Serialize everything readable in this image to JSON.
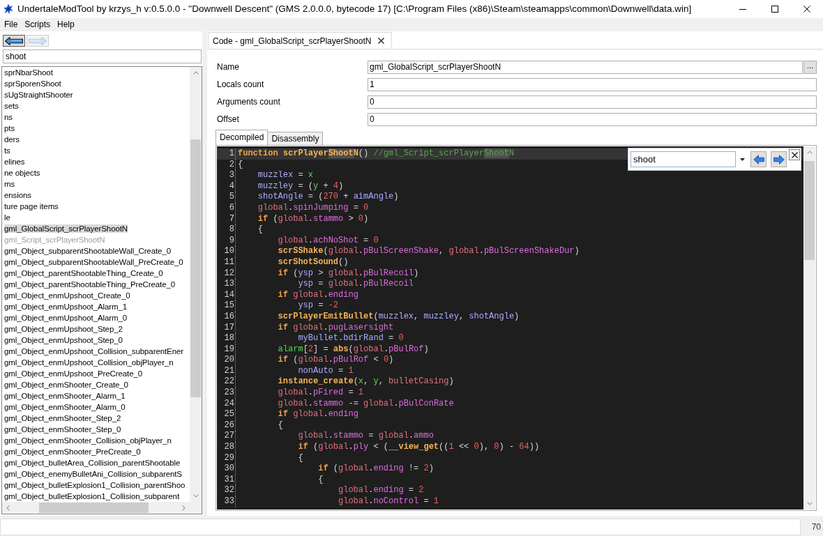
{
  "window": {
    "title": "UndertaleModTool by krzys_h v:0.5.0.0 - \"Downwell Descent\" (GMS 2.0.0.0, bytecode 17) [C:\\Program Files (x86)\\Steam\\steamapps\\common\\Downwell\\data.win]"
  },
  "menu": [
    "File",
    "Scripts",
    "Help"
  ],
  "navigation": {
    "back": {
      "disabled": false
    },
    "forward": {
      "disabled": true
    }
  },
  "tree": {
    "search": {
      "value": "shoot"
    },
    "items": [
      {
        "label": "sprNbarShoot",
        "selected": false,
        "dimmed": false
      },
      {
        "label": "sprSporenShoot",
        "selected": false,
        "dimmed": false
      },
      {
        "label": "sUgStraightShooter",
        "selected": false,
        "dimmed": false
      },
      {
        "label": "sets",
        "selected": false,
        "dimmed": false
      },
      {
        "label": "ns",
        "selected": false,
        "dimmed": false
      },
      {
        "label": "pts",
        "selected": false,
        "dimmed": false
      },
      {
        "label": "ders",
        "selected": false,
        "dimmed": false
      },
      {
        "label": "ts",
        "selected": false,
        "dimmed": false
      },
      {
        "label": "elines",
        "selected": false,
        "dimmed": false
      },
      {
        "label": "ne objects",
        "selected": false,
        "dimmed": false
      },
      {
        "label": "ms",
        "selected": false,
        "dimmed": false
      },
      {
        "label": "ensions",
        "selected": false,
        "dimmed": false
      },
      {
        "label": "ture page items",
        "selected": false,
        "dimmed": false
      },
      {
        "label": "le",
        "selected": false,
        "dimmed": false
      },
      {
        "label": "gml_GlobalScript_scrPlayerShootN",
        "selected": true,
        "dimmed": false
      },
      {
        "label": "gml_Script_scrPlayerShootN",
        "selected": false,
        "dimmed": true
      },
      {
        "label": "gml_Object_subparentShootableWall_Create_0",
        "selected": false,
        "dimmed": false
      },
      {
        "label": "gml_Object_subparentShootableWall_PreCreate_0",
        "selected": false,
        "dimmed": false
      },
      {
        "label": "gml_Object_parentShootableThing_Create_0",
        "selected": false,
        "dimmed": false
      },
      {
        "label": "gml_Object_parentShootableThing_PreCreate_0",
        "selected": false,
        "dimmed": false
      },
      {
        "label": "gml_Object_enmUpshoot_Create_0",
        "selected": false,
        "dimmed": false
      },
      {
        "label": "gml_Object_enmUpshoot_Alarm_1",
        "selected": false,
        "dimmed": false
      },
      {
        "label": "gml_Object_enmUpshoot_Alarm_0",
        "selected": false,
        "dimmed": false
      },
      {
        "label": "gml_Object_enmUpshoot_Step_2",
        "selected": false,
        "dimmed": false
      },
      {
        "label": "gml_Object_enmUpshoot_Step_0",
        "selected": false,
        "dimmed": false
      },
      {
        "label": "gml_Object_enmUpshoot_Collision_subparentEner",
        "selected": false,
        "dimmed": false
      },
      {
        "label": "gml_Object_enmUpshoot_Collision_objPlayer_n",
        "selected": false,
        "dimmed": false
      },
      {
        "label": "gml_Object_enmUpshoot_PreCreate_0",
        "selected": false,
        "dimmed": false
      },
      {
        "label": "gml_Object_enmShooter_Create_0",
        "selected": false,
        "dimmed": false
      },
      {
        "label": "gml_Object_enmShooter_Alarm_1",
        "selected": false,
        "dimmed": false
      },
      {
        "label": "gml_Object_enmShooter_Alarm_0",
        "selected": false,
        "dimmed": false
      },
      {
        "label": "gml_Object_enmShooter_Step_2",
        "selected": false,
        "dimmed": false
      },
      {
        "label": "gml_Object_enmShooter_Step_0",
        "selected": false,
        "dimmed": false
      },
      {
        "label": "gml_Object_enmShooter_Collision_objPlayer_n",
        "selected": false,
        "dimmed": false
      },
      {
        "label": "gml_Object_enmShooter_PreCreate_0",
        "selected": false,
        "dimmed": false
      },
      {
        "label": "gml_Object_bulletArea_Collision_parentShootable",
        "selected": false,
        "dimmed": false
      },
      {
        "label": "gml_Object_enemyBulletAni_Collision_subparentS",
        "selected": false,
        "dimmed": false
      },
      {
        "label": "gml_Object_bulletExplosion1_Collision_parentShoo",
        "selected": false,
        "dimmed": false
      },
      {
        "label": "gml_Object_bulletExplosion1_Collision_subparent",
        "selected": false,
        "dimmed": false
      }
    ]
  },
  "editor_tab": {
    "title": "Code - gml_GlobalScript_scrPlayerShootN"
  },
  "properties": [
    {
      "label": "Name",
      "value": "gml_GlobalScript_scrPlayerShootN",
      "button": "..."
    },
    {
      "label": "Locals count",
      "value": "1"
    },
    {
      "label": "Arguments count",
      "value": "0"
    },
    {
      "label": "Offset",
      "value": "0"
    }
  ],
  "code_tabs": [
    {
      "label": "Decompiled",
      "selected": true
    },
    {
      "label": "Disassembly",
      "selected": false
    }
  ],
  "code": {
    "lines": [
      {
        "number": "1",
        "current": true,
        "tokens": [
          {
            "kind": "keyword",
            "text": "function",
            "match": false
          },
          {
            "kind": "function",
            "text": " scrPlayer",
            "match": false
          },
          {
            "kind": "function",
            "text": "Shoot",
            "match": true
          },
          {
            "kind": "function",
            "text": "N",
            "match": false
          },
          {
            "kind": "punct",
            "text": "() ",
            "match": false
          },
          {
            "kind": "comment",
            "text": "//gml_Script_scrPlayer",
            "match": false
          },
          {
            "kind": "comment",
            "text": "Shoot",
            "match": true
          },
          {
            "kind": "comment",
            "text": "N",
            "match": false
          }
        ]
      },
      {
        "number": "2",
        "current": false,
        "tokens": [
          {
            "kind": "punct",
            "text": "{"
          }
        ],
        "children": [
          {
            "number": "3",
            "current": false,
            "tokens": [
              {
                "kind": "variable",
                "text": "muzzlex"
              },
              {
                "kind": "punct",
                "text": " = "
              },
              {
                "kind": "builtin",
                "text": "x"
              }
            ]
          },
          {
            "number": "4",
            "current": false,
            "tokens": [
              {
                "kind": "variable",
                "text": "muzzley"
              },
              {
                "kind": "punct",
                "text": " = ("
              },
              {
                "kind": "builtin",
                "text": "y"
              },
              {
                "kind": "punct",
                "text": " + "
              },
              {
                "kind": "number",
                "text": "4"
              },
              {
                "kind": "punct",
                "text": ")"
              }
            ]
          },
          {
            "number": "5",
            "current": false,
            "tokens": [
              {
                "kind": "variable",
                "text": "shotAngle"
              },
              {
                "kind": "punct",
                "text": " = ("
              },
              {
                "kind": "number",
                "text": "270"
              },
              {
                "kind": "punct",
                "text": " + "
              },
              {
                "kind": "variable",
                "text": "aimAngle"
              },
              {
                "kind": "punct",
                "text": ")"
              }
            ]
          },
          {
            "number": "6",
            "current": false,
            "tokens": [
              {
                "kind": "global",
                "text": "global"
              },
              {
                "kind": "punct",
                "text": "."
              },
              {
                "kind": "field",
                "text": "spinJumping"
              },
              {
                "kind": "punct",
                "text": " = "
              },
              {
                "kind": "number",
                "text": "0"
              }
            ]
          },
          {
            "number": "7",
            "current": false,
            "tokens": [
              {
                "kind": "keyword",
                "text": "if"
              },
              {
                "kind": "punct",
                "text": " ("
              },
              {
                "kind": "global",
                "text": "global"
              },
              {
                "kind": "punct",
                "text": "."
              },
              {
                "kind": "field",
                "text": "stammo"
              },
              {
                "kind": "punct",
                "text": " > "
              },
              {
                "kind": "number",
                "text": "0"
              },
              {
                "kind": "punct",
                "text": ")"
              }
            ]
          },
          {
            "number": "8",
            "current": false,
            "tokens": [
              {
                "kind": "punct",
                "text": "{"
              }
            ],
            "children": [
              {
                "number": "9",
                "current": false,
                "tokens": [
                  {
                    "kind": "global",
                    "text": "global"
                  },
                  {
                    "kind": "punct",
                    "text": "."
                  },
                  {
                    "kind": "field",
                    "text": "achNoShot"
                  },
                  {
                    "kind": "punct",
                    "text": " = "
                  },
                  {
                    "kind": "number",
                    "text": "0"
                  }
                ]
              },
              {
                "number": "10",
                "current": false,
                "tokens": [
                  {
                    "kind": "function",
                    "text": "scrSShake"
                  },
                  {
                    "kind": "punct",
                    "text": "("
                  },
                  {
                    "kind": "global",
                    "text": "global"
                  },
                  {
                    "kind": "punct",
                    "text": "."
                  },
                  {
                    "kind": "field",
                    "text": "pBulScreenShake"
                  },
                  {
                    "kind": "punct",
                    "text": ", "
                  },
                  {
                    "kind": "global",
                    "text": "global"
                  },
                  {
                    "kind": "punct",
                    "text": "."
                  },
                  {
                    "kind": "field",
                    "text": "pBulScreenShakeDur"
                  },
                  {
                    "kind": "punct",
                    "text": ")"
                  }
                ]
              },
              {
                "number": "11",
                "current": false,
                "tokens": [
                  {
                    "kind": "function",
                    "text": "scrShotSound"
                  },
                  {
                    "kind": "punct",
                    "text": "()"
                  }
                ]
              },
              {
                "number": "12",
                "current": false,
                "tokens": [
                  {
                    "kind": "keyword",
                    "text": "if"
                  },
                  {
                    "kind": "punct",
                    "text": " ("
                  },
                  {
                    "kind": "variable",
                    "text": "ysp"
                  },
                  {
                    "kind": "punct",
                    "text": " > "
                  },
                  {
                    "kind": "global",
                    "text": "global"
                  },
                  {
                    "kind": "punct",
                    "text": "."
                  },
                  {
                    "kind": "field",
                    "text": "pBulRecoil"
                  },
                  {
                    "kind": "punct",
                    "text": ")"
                  }
                ],
                "children": [
                  {
                    "number": "13",
                    "current": false,
                    "tokens": [
                      {
                        "kind": "variable",
                        "text": "ysp"
                      },
                      {
                        "kind": "punct",
                        "text": " = "
                      },
                      {
                        "kind": "global",
                        "text": "global"
                      },
                      {
                        "kind": "punct",
                        "text": "."
                      },
                      {
                        "kind": "field",
                        "text": "pBulRecoil"
                      }
                    ]
                  }
                ]
              },
              {
                "number": "14",
                "current": false,
                "tokens": [
                  {
                    "kind": "keyword",
                    "text": "if "
                  },
                  {
                    "kind": "global",
                    "text": "global"
                  },
                  {
                    "kind": "punct",
                    "text": "."
                  },
                  {
                    "kind": "field",
                    "text": "ending"
                  }
                ],
                "children": [
                  {
                    "number": "15",
                    "current": false,
                    "tokens": [
                      {
                        "kind": "variable",
                        "text": "ysp"
                      },
                      {
                        "kind": "punct",
                        "text": " = "
                      },
                      {
                        "kind": "number",
                        "text": "-2"
                      }
                    ]
                  }
                ]
              },
              {
                "number": "16",
                "current": false,
                "tokens": [
                  {
                    "kind": "function",
                    "text": "scrPlayerEmitBullet"
                  },
                  {
                    "kind": "punct",
                    "text": "("
                  },
                  {
                    "kind": "variable",
                    "text": "muzzlex"
                  },
                  {
                    "kind": "punct",
                    "text": ", "
                  },
                  {
                    "kind": "variable",
                    "text": "muzzley"
                  },
                  {
                    "kind": "punct",
                    "text": ", "
                  },
                  {
                    "kind": "variable",
                    "text": "shotAngle"
                  },
                  {
                    "kind": "punct",
                    "text": ")"
                  }
                ]
              },
              {
                "number": "17",
                "current": false,
                "tokens": [
                  {
                    "kind": "keyword",
                    "text": "if "
                  },
                  {
                    "kind": "global",
                    "text": "global"
                  },
                  {
                    "kind": "punct",
                    "text": "."
                  },
                  {
                    "kind": "field",
                    "text": "pugLasersight"
                  }
                ],
                "children": [
                  {
                    "number": "18",
                    "current": false,
                    "tokens": [
                      {
                        "kind": "variable",
                        "text": "myBullet"
                      },
                      {
                        "kind": "punct",
                        "text": "."
                      },
                      {
                        "kind": "variable",
                        "text": "bdirRand"
                      },
                      {
                        "kind": "punct",
                        "text": " = "
                      },
                      {
                        "kind": "number",
                        "text": "0"
                      }
                    ]
                  }
                ]
              },
              {
                "number": "19",
                "current": false,
                "tokens": [
                  {
                    "kind": "builtin",
                    "text": "alarm"
                  },
                  {
                    "kind": "punct",
                    "text": "["
                  },
                  {
                    "kind": "number",
                    "text": "2"
                  },
                  {
                    "kind": "punct",
                    "text": "] = "
                  },
                  {
                    "kind": "function",
                    "text": "abs"
                  },
                  {
                    "kind": "punct",
                    "text": "("
                  },
                  {
                    "kind": "global",
                    "text": "global"
                  },
                  {
                    "kind": "punct",
                    "text": "."
                  },
                  {
                    "kind": "field",
                    "text": "pBulRof"
                  },
                  {
                    "kind": "punct",
                    "text": ")"
                  }
                ]
              },
              {
                "number": "20",
                "current": false,
                "tokens": [
                  {
                    "kind": "keyword",
                    "text": "if"
                  },
                  {
                    "kind": "punct",
                    "text": " ("
                  },
                  {
                    "kind": "global",
                    "text": "global"
                  },
                  {
                    "kind": "punct",
                    "text": "."
                  },
                  {
                    "kind": "field",
                    "text": "pBulRof"
                  },
                  {
                    "kind": "punct",
                    "text": " < "
                  },
                  {
                    "kind": "number",
                    "text": "0"
                  },
                  {
                    "kind": "punct",
                    "text": ")"
                  }
                ],
                "children": [
                  {
                    "number": "21",
                    "current": false,
                    "tokens": [
                      {
                        "kind": "variable",
                        "text": "nonAuto"
                      },
                      {
                        "kind": "punct",
                        "text": " = "
                      },
                      {
                        "kind": "number",
                        "text": "1"
                      }
                    ]
                  }
                ]
              },
              {
                "number": "22",
                "current": false,
                "tokens": [
                  {
                    "kind": "function",
                    "text": "instance_create"
                  },
                  {
                    "kind": "punct",
                    "text": "("
                  },
                  {
                    "kind": "builtin",
                    "text": "x"
                  },
                  {
                    "kind": "punct",
                    "text": ", "
                  },
                  {
                    "kind": "builtin",
                    "text": "y"
                  },
                  {
                    "kind": "punct",
                    "text": ", "
                  },
                  {
                    "kind": "asset",
                    "text": "bulletCasing"
                  },
                  {
                    "kind": "punct",
                    "text": ")"
                  }
                ]
              },
              {
                "number": "23",
                "current": false,
                "tokens": [
                  {
                    "kind": "global",
                    "text": "global"
                  },
                  {
                    "kind": "punct",
                    "text": "."
                  },
                  {
                    "kind": "field",
                    "text": "pFired"
                  },
                  {
                    "kind": "punct",
                    "text": " = "
                  },
                  {
                    "kind": "number",
                    "text": "1"
                  }
                ]
              },
              {
                "number": "24",
                "current": false,
                "tokens": [
                  {
                    "kind": "global",
                    "text": "global"
                  },
                  {
                    "kind": "punct",
                    "text": "."
                  },
                  {
                    "kind": "field",
                    "text": "stammo"
                  },
                  {
                    "kind": "punct",
                    "text": " -= "
                  },
                  {
                    "kind": "global",
                    "text": "global"
                  },
                  {
                    "kind": "punct",
                    "text": "."
                  },
                  {
                    "kind": "field",
                    "text": "pBulConRate"
                  }
                ]
              },
              {
                "number": "25",
                "current": false,
                "tokens": [
                  {
                    "kind": "keyword",
                    "text": "if "
                  },
                  {
                    "kind": "global",
                    "text": "global"
                  },
                  {
                    "kind": "punct",
                    "text": "."
                  },
                  {
                    "kind": "field",
                    "text": "ending"
                  }
                ]
              },
              {
                "number": "26",
                "current": false,
                "tokens": [
                  {
                    "kind": "punct",
                    "text": "{"
                  }
                ],
                "children": [
                  {
                    "number": "27",
                    "current": false,
                    "tokens": [
                      {
                        "kind": "global",
                        "text": "global"
                      },
                      {
                        "kind": "punct",
                        "text": "."
                      },
                      {
                        "kind": "field",
                        "text": "stammo"
                      },
                      {
                        "kind": "punct",
                        "text": " = "
                      },
                      {
                        "kind": "global",
                        "text": "global"
                      },
                      {
                        "kind": "punct",
                        "text": "."
                      },
                      {
                        "kind": "field",
                        "text": "ammo"
                      }
                    ]
                  },
                  {
                    "number": "28",
                    "current": false,
                    "tokens": [
                      {
                        "kind": "keyword",
                        "text": "if"
                      },
                      {
                        "kind": "punct",
                        "text": " ("
                      },
                      {
                        "kind": "global",
                        "text": "global"
                      },
                      {
                        "kind": "punct",
                        "text": "."
                      },
                      {
                        "kind": "field",
                        "text": "ply"
                      },
                      {
                        "kind": "punct",
                        "text": " < ("
                      },
                      {
                        "kind": "function",
                        "text": "__view_get"
                      },
                      {
                        "kind": "punct",
                        "text": "(("
                      },
                      {
                        "kind": "number",
                        "text": "1"
                      },
                      {
                        "kind": "punct",
                        "text": " << "
                      },
                      {
                        "kind": "number",
                        "text": "0"
                      },
                      {
                        "kind": "punct",
                        "text": "), "
                      },
                      {
                        "kind": "number",
                        "text": "0"
                      },
                      {
                        "kind": "punct",
                        "text": ") - "
                      },
                      {
                        "kind": "number",
                        "text": "64"
                      },
                      {
                        "kind": "punct",
                        "text": "))"
                      }
                    ]
                  },
                  {
                    "number": "29",
                    "current": false,
                    "tokens": [
                      {
                        "kind": "punct",
                        "text": "{"
                      }
                    ],
                    "children": [
                      {
                        "number": "30",
                        "current": false,
                        "tokens": [
                          {
                            "kind": "keyword",
                            "text": "if"
                          },
                          {
                            "kind": "punct",
                            "text": " ("
                          },
                          {
                            "kind": "global",
                            "text": "global"
                          },
                          {
                            "kind": "punct",
                            "text": "."
                          },
                          {
                            "kind": "field",
                            "text": "ending"
                          },
                          {
                            "kind": "punct",
                            "text": " != "
                          },
                          {
                            "kind": "number",
                            "text": "2"
                          },
                          {
                            "kind": "punct",
                            "text": ")"
                          }
                        ]
                      },
                      {
                        "number": "31",
                        "current": false,
                        "tokens": [
                          {
                            "kind": "punct",
                            "text": "{"
                          }
                        ],
                        "children": [
                          {
                            "number": "32",
                            "current": false,
                            "tokens": [
                              {
                                "kind": "global",
                                "text": "global"
                              },
                              {
                                "kind": "punct",
                                "text": "."
                              },
                              {
                                "kind": "field",
                                "text": "ending"
                              },
                              {
                                "kind": "punct",
                                "text": " = "
                              },
                              {
                                "kind": "number",
                                "text": "2"
                              }
                            ]
                          },
                          {
                            "number": "33",
                            "current": false,
                            "tokens": [
                              {
                                "kind": "global",
                                "text": "global"
                              },
                              {
                                "kind": "punct",
                                "text": "."
                              },
                              {
                                "kind": "field",
                                "text": "noControl"
                              },
                              {
                                "kind": "punct",
                                "text": " = "
                              },
                              {
                                "kind": "number",
                                "text": "1"
                              }
                            ]
                          }
                        ]
                      }
                    ]
                  }
                ]
              }
            ]
          }
        ]
      }
    ]
  },
  "find": {
    "query": "shoot"
  },
  "status_bar": {
    "value": "70"
  }
}
